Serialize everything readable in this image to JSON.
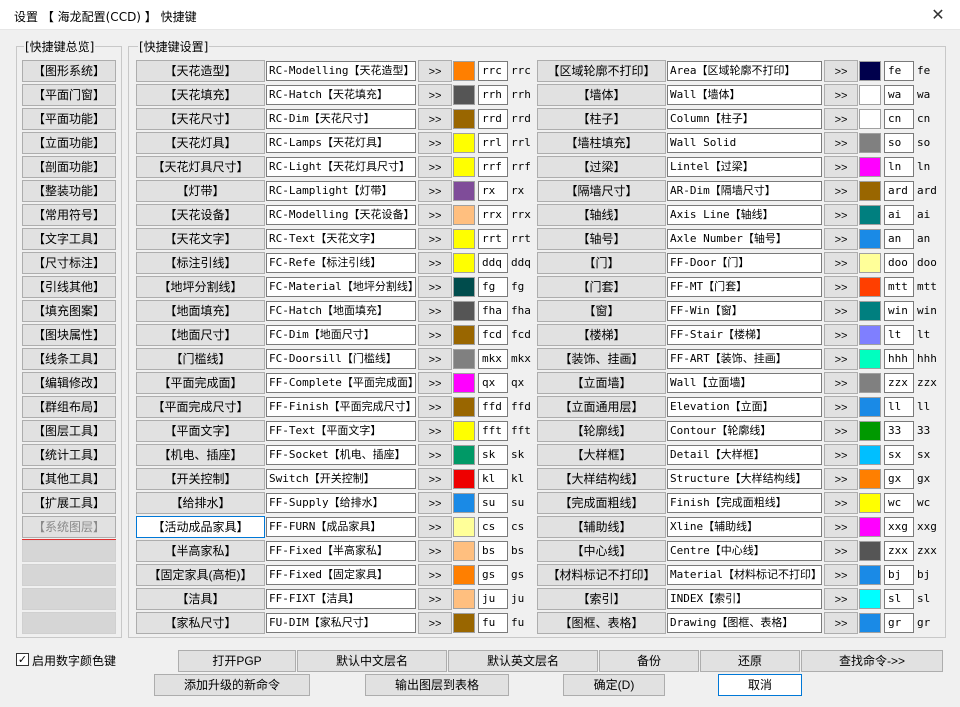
{
  "window": {
    "title": "设置 【 海龙配置(CCD) 】 快捷键",
    "close_glyph": "✕"
  },
  "overview": {
    "label": "[快捷键总览]",
    "items": [
      "【图形系统】",
      "【平面门窗】",
      "【平面功能】",
      "【立面功能】",
      "【剖面功能】",
      "【整装功能】",
      "【常用符号】",
      "【文字工具】",
      "【尺寸标注】",
      "【引线其他】",
      "【填充图案】",
      "【图块属性】",
      "【线条工具】",
      "【编辑修改】",
      "【群组布局】",
      "【图层工具】",
      "【统计工具】",
      "【其他工具】",
      "【扩展工具】",
      "【系统图层】"
    ],
    "empty_slots": 4
  },
  "settings": {
    "label": "[快捷键设置]",
    "arrow_label": ">>",
    "left": [
      {
        "name": "【天花造型】",
        "cmd": "RC-Modelling【天花造型】",
        "color": "#ff7f00",
        "code": "rrc",
        "plain": "rrc"
      },
      {
        "name": "【天花填充】",
        "cmd": "RC-Hatch【天花填充】",
        "color": "#555555",
        "code": "rrh",
        "plain": "rrh"
      },
      {
        "name": "【天花尺寸】",
        "cmd": "RC-Dim【天花尺寸】",
        "color": "#996600",
        "code": "rrd",
        "plain": "rrd"
      },
      {
        "name": "【天花灯具】",
        "cmd": "RC-Lamps【天花灯具】",
        "color": "#ffff00",
        "code": "rrl",
        "plain": "rrl"
      },
      {
        "name": "【天花灯具尺寸】",
        "cmd": "RC-Light【天花灯具尺寸】",
        "color": "#ffff00",
        "code": "rrf",
        "plain": "rrf"
      },
      {
        "name": "【灯带】",
        "cmd": "RC-Lamplight【灯带】",
        "color": "#7f4c99",
        "code": "rx",
        "plain": "rx"
      },
      {
        "name": "【天花设备】",
        "cmd": "RC-Modelling【天花设备】",
        "color": "#ffbf7f",
        "code": "rrx",
        "plain": "rrx"
      },
      {
        "name": "【天花文字】",
        "cmd": "RC-Text【天花文字】",
        "color": "#ffff00",
        "code": "rrt",
        "plain": "rrt"
      },
      {
        "name": "【标注引线】",
        "cmd": "FC-Refe【标注引线】",
        "color": "#ffff00",
        "code": "ddq",
        "plain": "ddq"
      },
      {
        "name": "【地坪分割线】",
        "cmd": "FC-Material【地坪分割线】",
        "color": "#004c4c",
        "code": "fg",
        "plain": "fg"
      },
      {
        "name": "【地面填充】",
        "cmd": "FC-Hatch【地面填充】",
        "color": "#555555",
        "code": "fha",
        "plain": "fha"
      },
      {
        "name": "【地面尺寸】",
        "cmd": "FC-Dim【地面尺寸】",
        "color": "#996600",
        "code": "fcd",
        "plain": "fcd"
      },
      {
        "name": "【门槛线】",
        "cmd": "FC-Doorsill【门槛线】",
        "color": "#808080",
        "code": "mkx",
        "plain": "mkx"
      },
      {
        "name": "【平面完成面】",
        "cmd": "FF-Complete【平面完成面】",
        "color": "#ff00ff",
        "code": "qx",
        "plain": "qx"
      },
      {
        "name": "【平面完成尺寸】",
        "cmd": "FF-Finish【平面完成尺寸】",
        "color": "#996600",
        "code": "ffd",
        "plain": "ffd"
      },
      {
        "name": "【平面文字】",
        "cmd": "FF-Text【平面文字】",
        "color": "#ffff00",
        "code": "fft",
        "plain": "fft"
      },
      {
        "name": "【机电、插座】",
        "cmd": "FF-Socket【机电、插座】",
        "color": "#009966",
        "code": "sk",
        "plain": "sk"
      },
      {
        "name": "【开关控制】",
        "cmd": "Switch【开关控制】",
        "color": "#ee0000",
        "code": "kl",
        "plain": "kl"
      },
      {
        "name": "【给排水】",
        "cmd": "FF-Supply【给排水】",
        "color": "#1a8ae6",
        "code": "su",
        "plain": "su"
      },
      {
        "name": "【活动成品家具】",
        "cmd": "FF-FURN【成品家具】",
        "color": "#ffff99",
        "code": "cs",
        "plain": "cs"
      },
      {
        "name": "【半高家私】",
        "cmd": "FF-Fixed【半高家私】",
        "color": "#ffbf7f",
        "code": "bs",
        "plain": "bs"
      },
      {
        "name": "【固定家具(高柜)】",
        "cmd": "FF-Fixed【固定家具】",
        "color": "#ff7f00",
        "code": "gs",
        "plain": "gs"
      },
      {
        "name": "【洁具】",
        "cmd": "FF-FIXT【洁具】",
        "color": "#ffbf7f",
        "code": "ju",
        "plain": "ju"
      },
      {
        "name": "【家私尺寸】",
        "cmd": "FU-DIM【家私尺寸】",
        "color": "#996600",
        "code": "fu",
        "plain": "fu"
      }
    ],
    "right": [
      {
        "name": "【区域轮廓不打印】",
        "cmd": "Area【区域轮廓不打印】",
        "color": "#00004c",
        "code": "fe",
        "plain": "fe"
      },
      {
        "name": "【墙体】",
        "cmd": "Wall【墙体】",
        "color": "#ffffff",
        "code": "wa",
        "plain": "wa"
      },
      {
        "name": "【柱子】",
        "cmd": "Column【柱子】",
        "color": "#ffffff",
        "code": "cn",
        "plain": "cn"
      },
      {
        "name": "【墙柱填充】",
        "cmd": "Wall Solid",
        "color": "#808080",
        "code": "so",
        "plain": "so"
      },
      {
        "name": "【过梁】",
        "cmd": "Lintel【过梁】",
        "color": "#ff00ff",
        "code": "ln",
        "plain": "ln"
      },
      {
        "name": "【隔墙尺寸】",
        "cmd": "AR-Dim【隔墙尺寸】",
        "color": "#996600",
        "code": "ard",
        "plain": "ard"
      },
      {
        "name": "【轴线】",
        "cmd": "Axis Line【轴线】",
        "color": "#007f7f",
        "code": "ai",
        "plain": "ai"
      },
      {
        "name": "【轴号】",
        "cmd": "Axle Number【轴号】",
        "color": "#1a8ae6",
        "code": "an",
        "plain": "an"
      },
      {
        "name": "【门】",
        "cmd": "FF-Door【门】",
        "color": "#ffff99",
        "code": "doo",
        "plain": "doo"
      },
      {
        "name": "【门套】",
        "cmd": "FF-MT【门套】",
        "color": "#ff3f00",
        "code": "mtt",
        "plain": "mtt"
      },
      {
        "name": "【窗】",
        "cmd": "FF-Win【窗】",
        "color": "#007f7f",
        "code": "win",
        "plain": "win"
      },
      {
        "name": "【楼梯】",
        "cmd": "FF-Stair【楼梯】",
        "color": "#7f7fff",
        "code": "lt",
        "plain": "lt"
      },
      {
        "name": "【装饰、挂画】",
        "cmd": "FF-ART【装饰、挂画】",
        "color": "#00ffbf",
        "code": "hhh",
        "plain": "hhh"
      },
      {
        "name": "【立面墙】",
        "cmd": "Wall【立面墙】",
        "color": "#808080",
        "code": "zzx",
        "plain": "zzx"
      },
      {
        "name": "【立面通用层】",
        "cmd": "Elevation【立面】",
        "color": "#1a8ae6",
        "code": "ll",
        "plain": "ll"
      },
      {
        "name": "【轮廓线】",
        "cmd": "Contour【轮廓线】",
        "color": "#009900",
        "code": "33",
        "plain": "33"
      },
      {
        "name": "【大样框】",
        "cmd": "Detail【大样框】",
        "color": "#00bfff",
        "code": "sx",
        "plain": "sx"
      },
      {
        "name": "【大样结构线】",
        "cmd": "Structure【大样结构线】",
        "color": "#ff7f00",
        "code": "gx",
        "plain": "gx"
      },
      {
        "name": "【完成面粗线】",
        "cmd": "Finish【完成面粗线】",
        "color": "#ffff00",
        "code": "wc",
        "plain": "wc"
      },
      {
        "name": "【辅助线】",
        "cmd": "Xline【辅助线】",
        "color": "#ff00ff",
        "code": "xxg",
        "plain": "xxg"
      },
      {
        "name": "【中心线】",
        "cmd": "Centre【中心线】",
        "color": "#555555",
        "code": "zxx",
        "plain": "zxx"
      },
      {
        "name": "【材料标记不打印】",
        "cmd": "Material【材料标记不打印】",
        "color": "#1a8ae6",
        "code": "bj",
        "plain": "bj"
      },
      {
        "name": "【索引】",
        "cmd": "INDEX【索引】",
        "color": "#00ffff",
        "code": "sl",
        "plain": "sl"
      },
      {
        "name": "【图框、表格】",
        "cmd": "Drawing【图框、表格】",
        "color": "#1a8ae6",
        "code": "gr",
        "plain": "gr"
      }
    ]
  },
  "footer": {
    "checkbox_label": "启用数字颜色键",
    "checkbox_checked": true,
    "checkmark": "✓",
    "row1": [
      "打开PGP",
      "默认中文层名",
      "默认英文层名",
      "备份",
      "还原",
      "查找命令->>"
    ],
    "row2": [
      "添加升级的新命令",
      "输出图层到表格",
      "确定(D)",
      "取消"
    ]
  }
}
